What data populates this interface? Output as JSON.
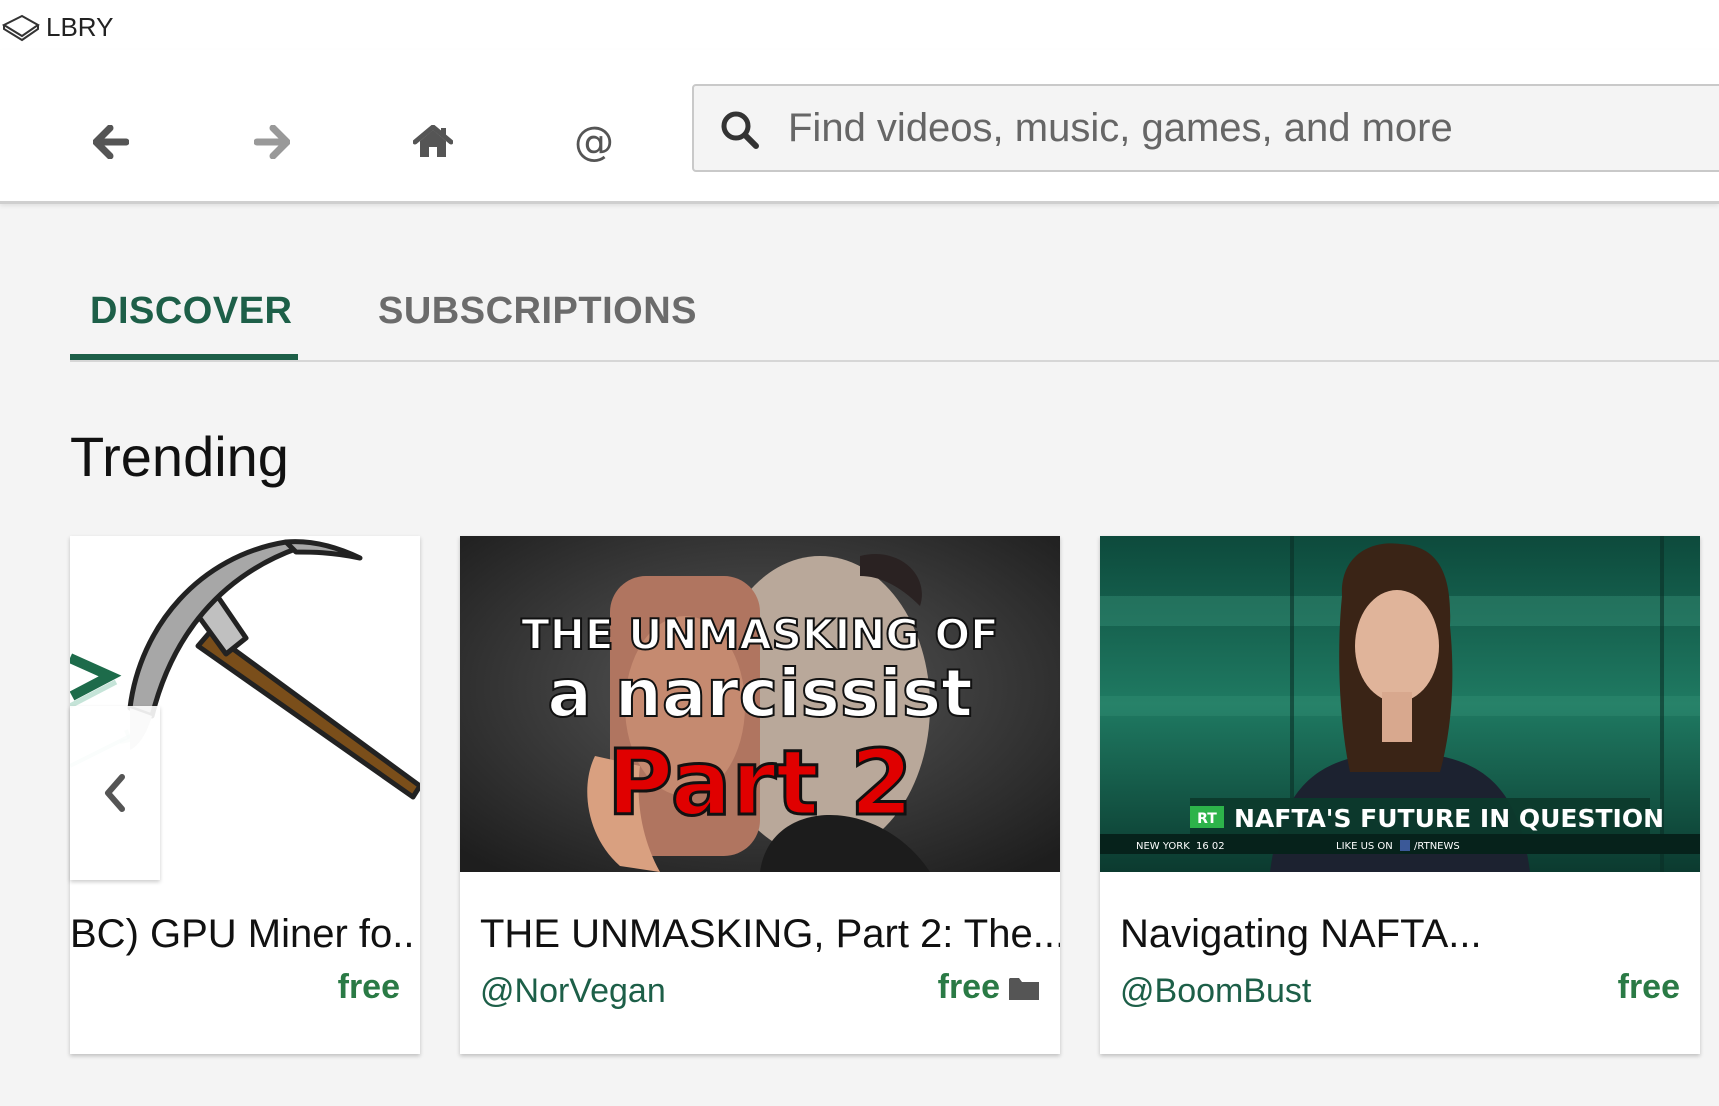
{
  "app": {
    "title": "LBRY"
  },
  "icons": {
    "logo": "lbry-logo-icon",
    "back": "arrow-left-icon",
    "forward": "arrow-right-icon",
    "home": "home-icon",
    "channels": "at-icon",
    "search": "search-icon",
    "scroll_left": "chevron-left-icon",
    "folder": "folder-icon"
  },
  "nav": {
    "channels_label": "@"
  },
  "search": {
    "placeholder": "Find videos, music, games, and more"
  },
  "tabs": [
    {
      "label": "DISCOVER",
      "active": true
    },
    {
      "label": "SUBSCRIPTIONS",
      "active": false
    }
  ],
  "section": {
    "title": "Trending"
  },
  "cards": [
    {
      "title": "BC) GPU Miner fo..",
      "channel": "",
      "price": "free",
      "has_folder": false
    },
    {
      "title": "THE UNMASKING, Part 2: The...",
      "channel": "@NorVegan",
      "price": "free",
      "has_folder": true,
      "thumb_text": {
        "line1": "THE UNMASKING OF",
        "line2": "a narcissist",
        "line3": "Part 2"
      }
    },
    {
      "title": "Navigating NAFTA...",
      "channel": "@BoomBust",
      "price": "free",
      "has_folder": false,
      "thumb_text": {
        "logo": "RT",
        "headline": "NAFTA'S FUTURE IN QUESTION",
        "location": "NEW YORK",
        "time": "16 02",
        "social_prefix": "LIKE US ON",
        "social_handle": "/RTNEWS"
      }
    }
  ],
  "colors": {
    "accent": "#1d5f48",
    "price": "#2a7a45",
    "red": "#e00000"
  }
}
